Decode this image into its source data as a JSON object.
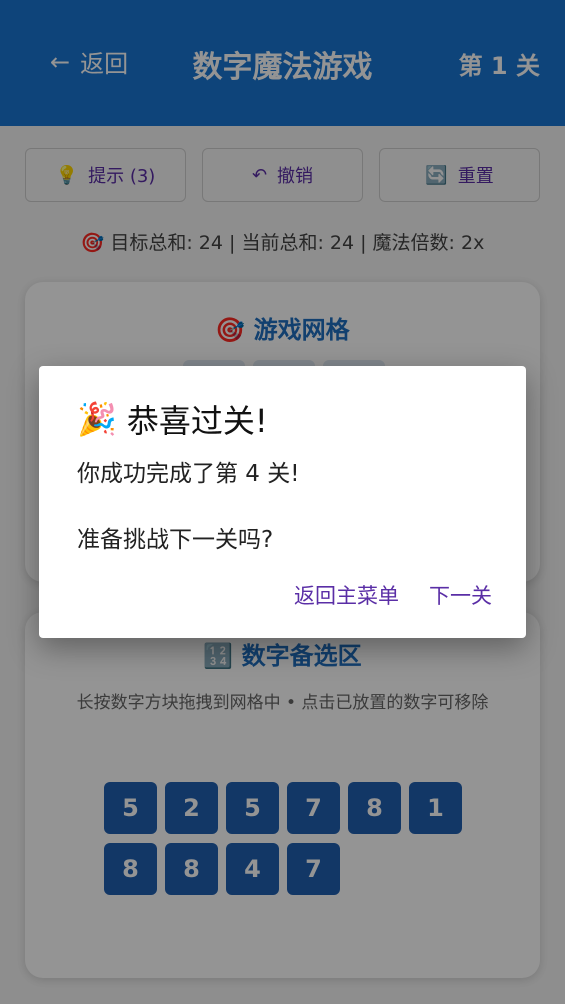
{
  "header": {
    "back_arrow": "←",
    "back_label": "返回",
    "title": "数字魔法游戏",
    "level": "第 1 关"
  },
  "toolbar": {
    "hint_icon": "💡",
    "hint_label": "提示 (3)",
    "undo_icon": "↶",
    "undo_label": "撤销",
    "reset_icon": "🔄",
    "reset_label": "重置"
  },
  "status": {
    "icon": "🎯",
    "text": "目标总和: 24 | 当前总和: 24 | 魔法倍数: 2x"
  },
  "grid_card": {
    "icon": "🎯",
    "title": "游戏网格"
  },
  "pool_card": {
    "icon": "🔢",
    "title": "数字备选区",
    "hint": "长按数字方块拖拽到网格中 • 点击已放置的数字可移除",
    "tiles_row1": [
      "5",
      "2",
      "5",
      "7",
      "8",
      "1"
    ],
    "tiles_row2": [
      "8",
      "8",
      "4",
      "7"
    ]
  },
  "dialog": {
    "icon": "🎉",
    "title": "恭喜过关!",
    "line1": "你成功完成了第 4 关!",
    "line2": "准备挑战下一关吗?",
    "btn_menu": "返回主菜单",
    "btn_next": "下一关"
  },
  "colors": {
    "header_bg": "#1976d2",
    "accent_purple": "#5a2ea6",
    "tile_blue": "#1f5fb0",
    "card_title_blue": "#1f6fc0"
  }
}
